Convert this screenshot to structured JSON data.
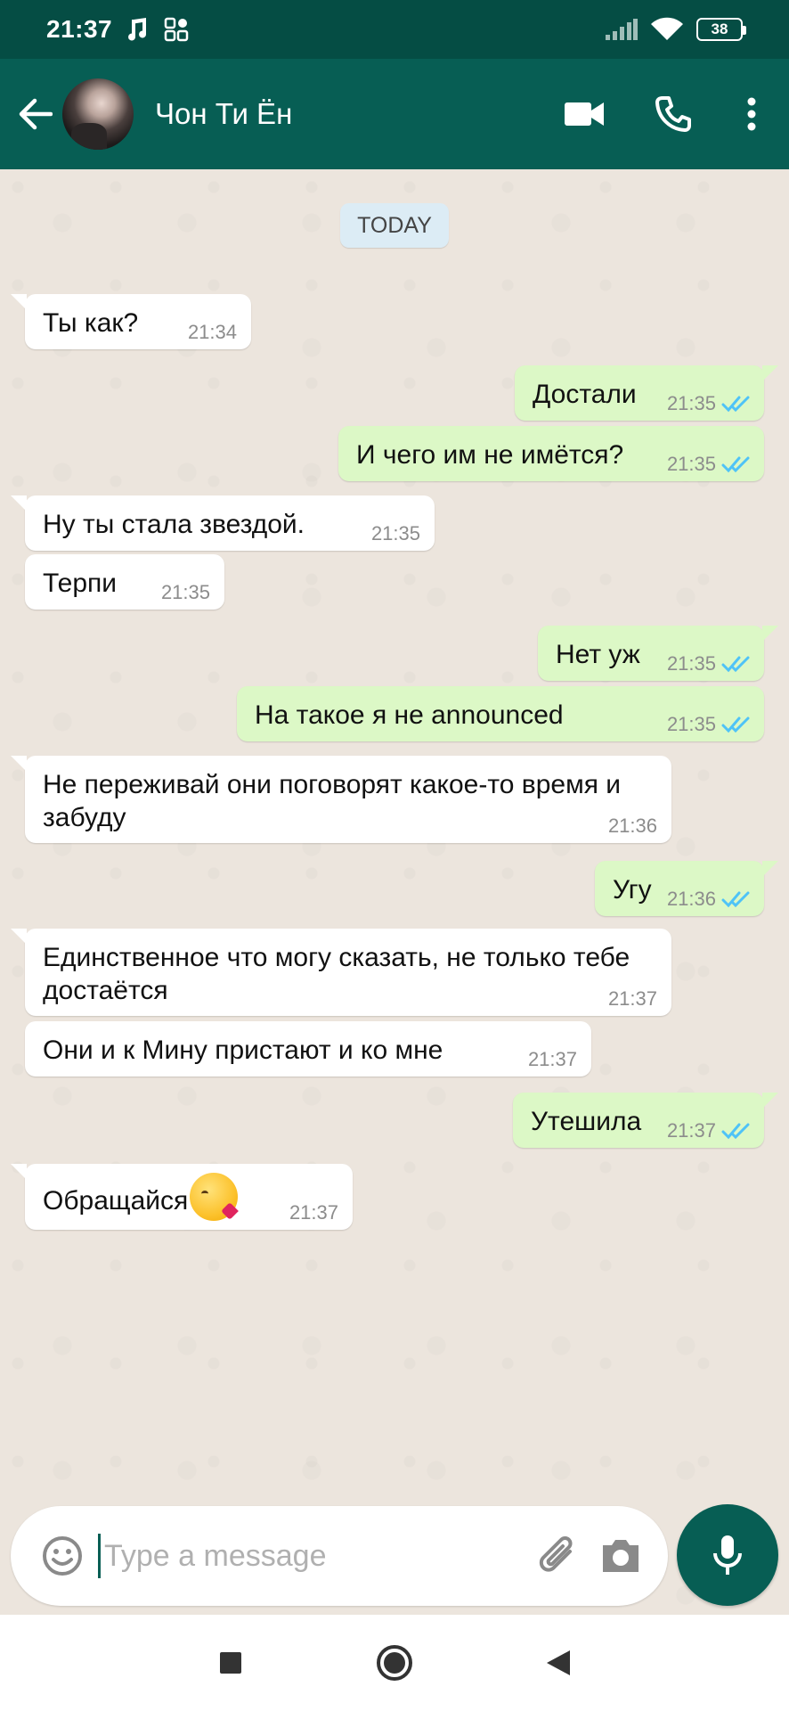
{
  "status_bar": {
    "time": "21:37",
    "battery": "38"
  },
  "app_bar": {
    "contact_name": "Чон Ти Ён",
    "icons": [
      "back-arrow-icon",
      "video-call-icon",
      "phone-icon",
      "more-vert-icon"
    ]
  },
  "chat": {
    "date_chip": "TODAY",
    "messages": [
      {
        "dir": "in",
        "text": "Ты как?",
        "time": "21:34"
      },
      {
        "dir": "out",
        "text": "Достали",
        "time": "21:35",
        "status": "read"
      },
      {
        "dir": "out",
        "text": "И чего им не имётся?",
        "time": "21:35",
        "status": "read"
      },
      {
        "dir": "in",
        "text": "Ну ты стала звездой.",
        "time": "21:35"
      },
      {
        "dir": "in",
        "text": "Терпи",
        "time": "21:35"
      },
      {
        "dir": "out",
        "text": "Нет уж",
        "time": "21:35",
        "status": "read"
      },
      {
        "dir": "out",
        "text": "На такое я не announced",
        "time": "21:35",
        "status": "read"
      },
      {
        "dir": "in",
        "text": "Не переживай они поговорят какое-то время и забуду",
        "time": "21:36"
      },
      {
        "dir": "out",
        "text": "Угу",
        "time": "21:36",
        "status": "read"
      },
      {
        "dir": "in",
        "text": "Единственное что могу сказать, не только тебе достаётся",
        "time": "21:37"
      },
      {
        "dir": "in",
        "text": "Они и к Мину пристают и ко мне",
        "time": "21:37"
      },
      {
        "dir": "out",
        "text": "Утешила",
        "time": "21:37",
        "status": "read"
      },
      {
        "dir": "in",
        "text": "Обращайся",
        "time": "21:37",
        "emoji": "kissing-face-emoji"
      }
    ]
  },
  "composer": {
    "placeholder": "Type a message"
  },
  "colors": {
    "header": "#075e54",
    "status_bar": "#054d44",
    "outgoing": "#dcf8c6",
    "incoming": "#ffffff",
    "read_ticks": "#4fc3f7"
  }
}
